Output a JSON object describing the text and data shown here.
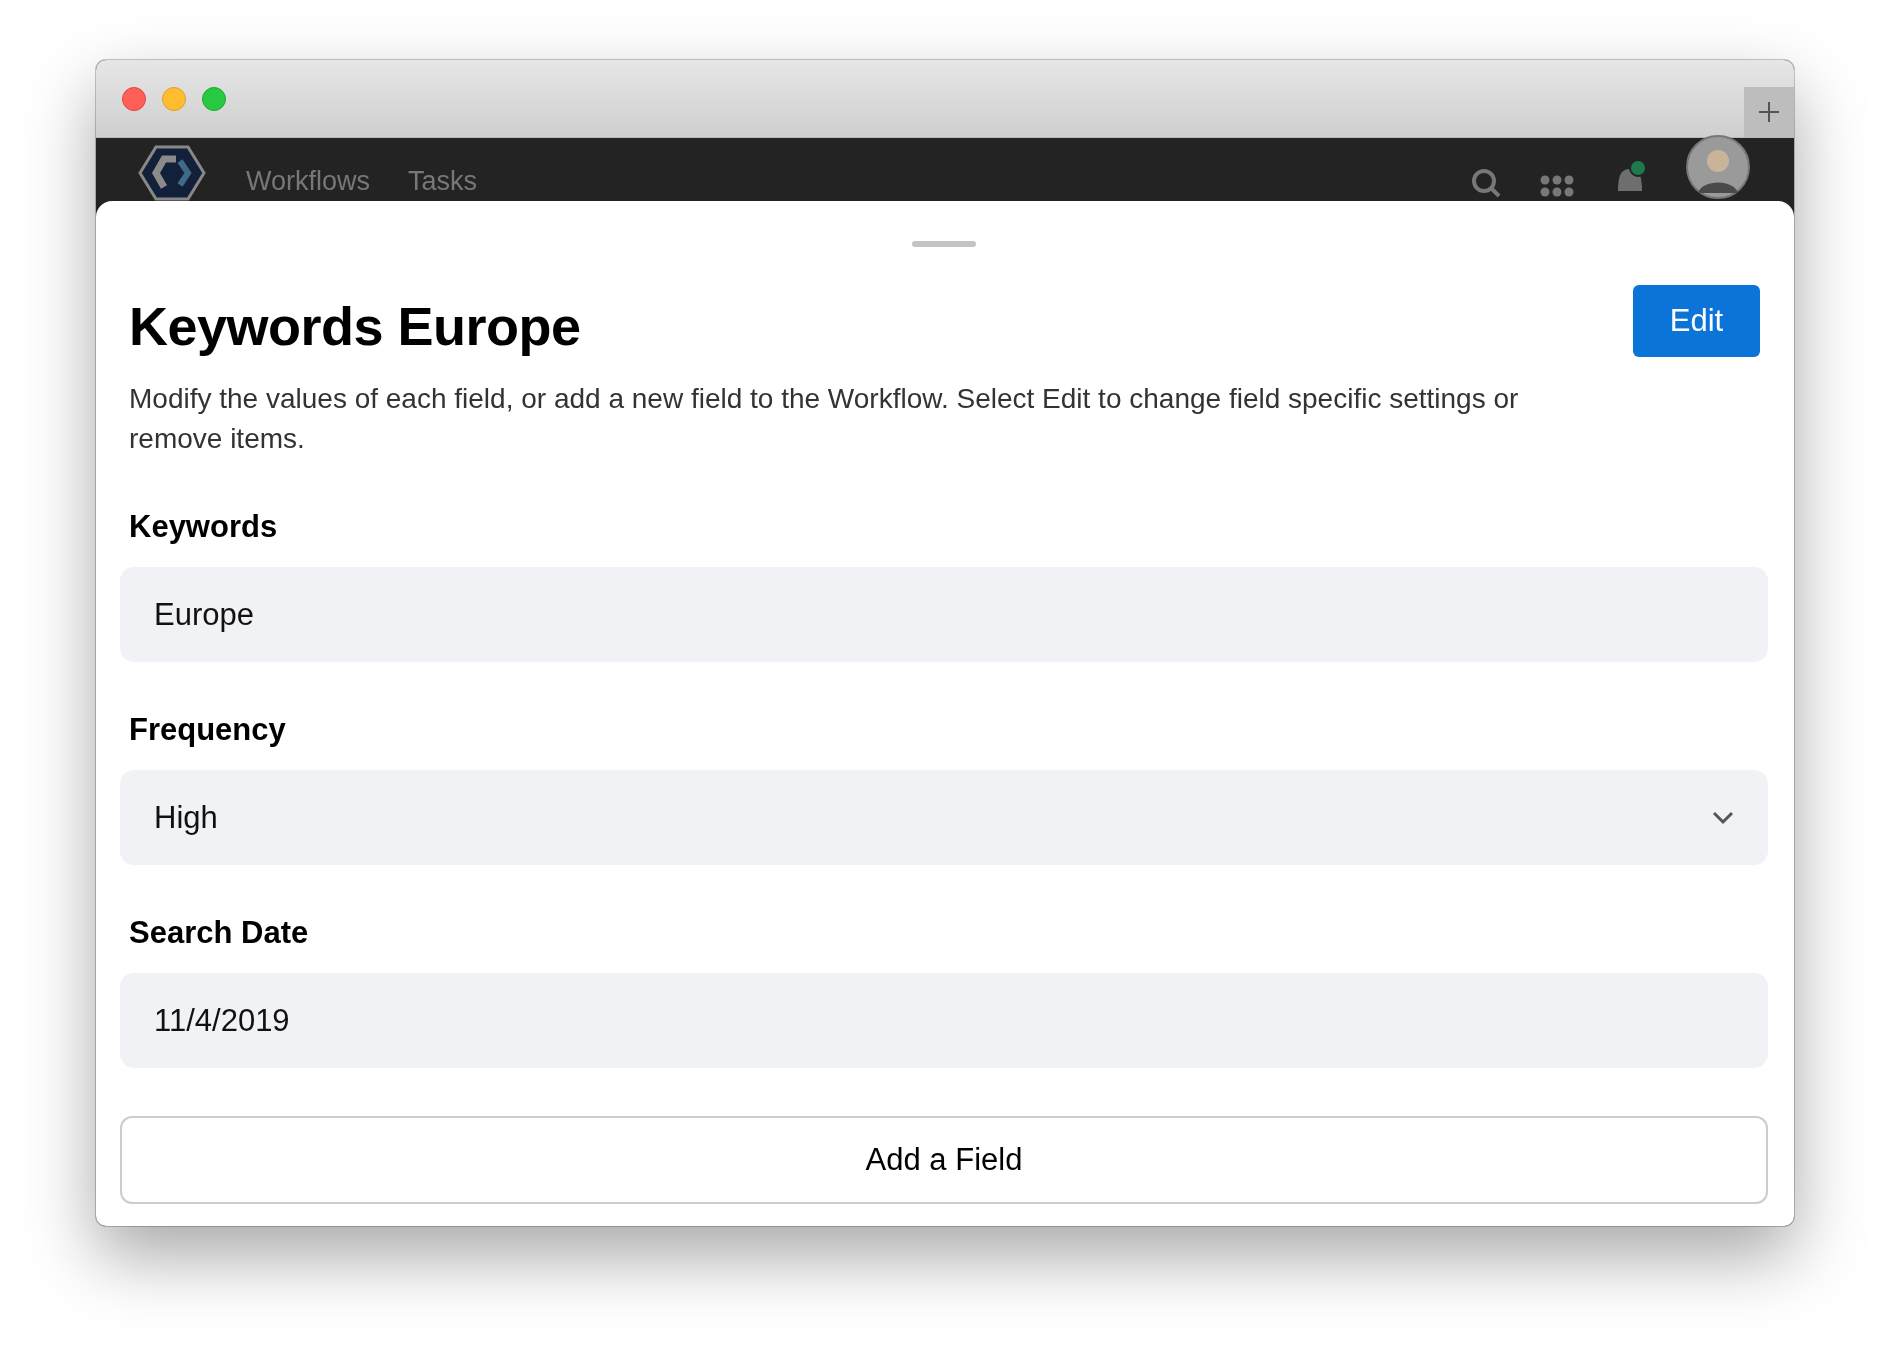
{
  "nav": {
    "items": [
      {
        "label": "Workflows"
      },
      {
        "label": "Tasks"
      }
    ]
  },
  "sheet": {
    "title": "Keywords Europe",
    "edit_button": "Edit",
    "description": "Modify the values of each field, or add a new field to the Workflow. Select Edit to change field specific settings or remove items.",
    "fields": [
      {
        "label": "Keywords",
        "value": "Europe",
        "kind": "text"
      },
      {
        "label": "Frequency",
        "value": "High",
        "kind": "select"
      },
      {
        "label": "Search Date",
        "value": "11/4/2019",
        "kind": "text"
      }
    ],
    "add_button": "Add a Field"
  }
}
